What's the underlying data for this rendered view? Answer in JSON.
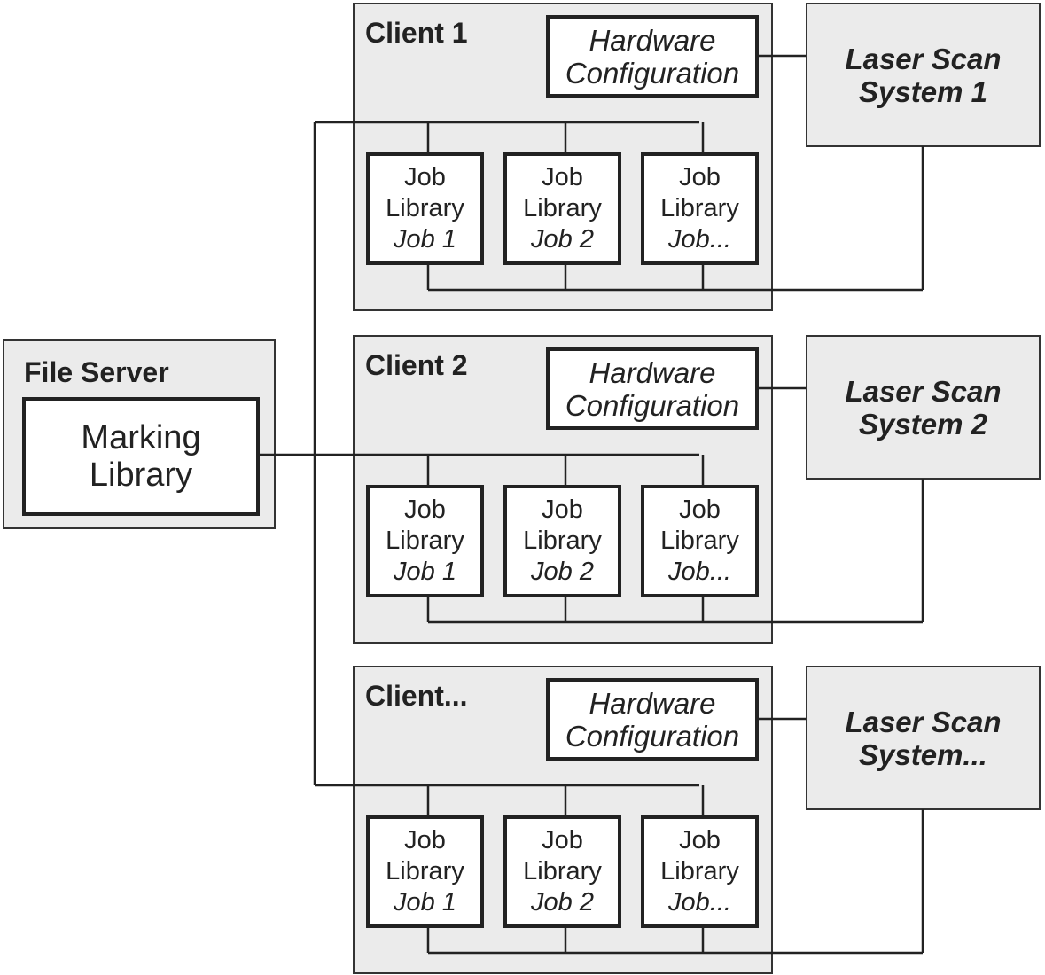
{
  "file_server": {
    "title": "File Server",
    "marking_library": [
      "Marking",
      "Library"
    ]
  },
  "clients": [
    {
      "title": "Client 1",
      "hardware": [
        "Hardware",
        "Configuration"
      ],
      "laser": [
        "Laser Scan",
        "System 1"
      ],
      "jobs": [
        [
          "Job",
          "Library",
          "Job 1"
        ],
        [
          "Job",
          "Library",
          "Job 2"
        ],
        [
          "Job",
          "Library",
          "Job..."
        ]
      ]
    },
    {
      "title": "Client 2",
      "hardware": [
        "Hardware",
        "Configuration"
      ],
      "laser": [
        "Laser Scan",
        "System 2"
      ],
      "jobs": [
        [
          "Job",
          "Library",
          "Job 1"
        ],
        [
          "Job",
          "Library",
          "Job 2"
        ],
        [
          "Job",
          "Library",
          "Job..."
        ]
      ]
    },
    {
      "title": "Client...",
      "hardware": [
        "Hardware",
        "Configuration"
      ],
      "laser": [
        "Laser Scan",
        "System..."
      ],
      "jobs": [
        [
          "Job",
          "Library",
          "Job 1"
        ],
        [
          "Job",
          "Library",
          "Job 2"
        ],
        [
          "Job",
          "Library",
          "Job..."
        ]
      ]
    }
  ],
  "colors": {
    "box_fill": "#ebebeb",
    "line": "#222222"
  }
}
